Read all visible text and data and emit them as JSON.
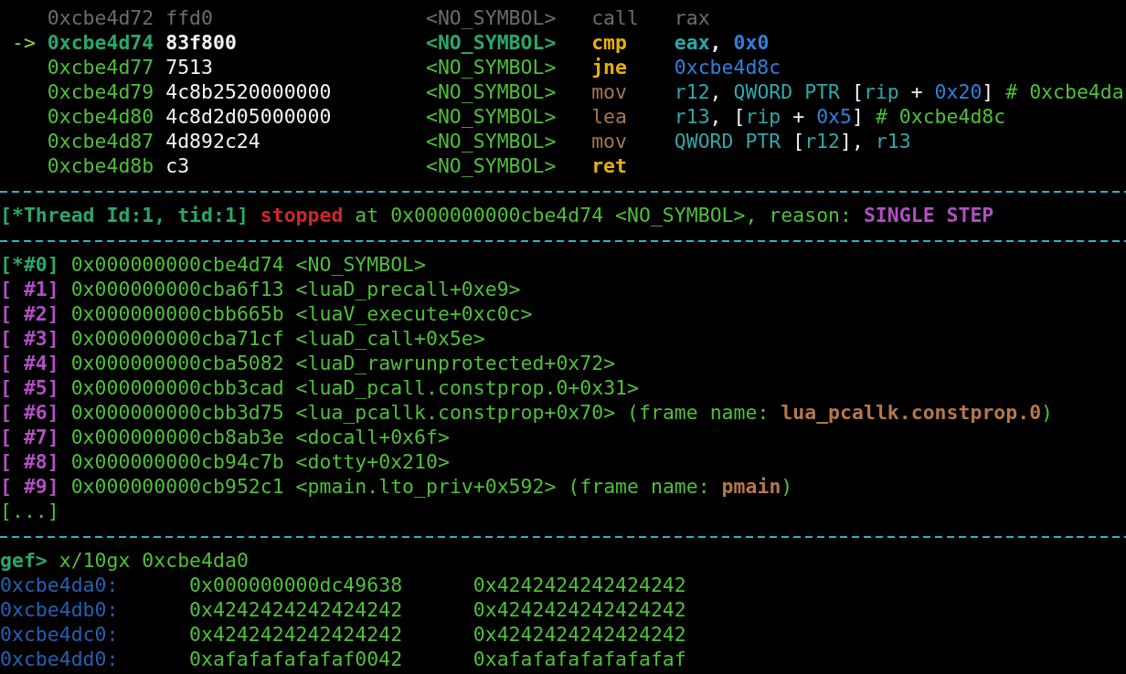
{
  "disassembly": [
    {
      "current": false,
      "dimmed": true,
      "address": "0xcbe4d72",
      "bytes": "ffd0",
      "symbol": "<NO_SYMBOL>",
      "mnemonic": "call",
      "emphasized": false,
      "operands": [
        {
          "text": "rax",
          "kind": "register"
        }
      ]
    },
    {
      "current": true,
      "dimmed": false,
      "marker": "->",
      "address": "0xcbe4d74",
      "bytes": "83f800",
      "symbol": "<NO_SYMBOL>",
      "mnemonic": "cmp",
      "emphasized": true,
      "operands": [
        {
          "text": "eax",
          "kind": "register"
        },
        {
          "text": ", ",
          "kind": "punct"
        },
        {
          "text": "0x0",
          "kind": "immediate"
        }
      ]
    },
    {
      "current": false,
      "dimmed": false,
      "address": "0xcbe4d77",
      "bytes": "7513",
      "symbol": "<NO_SYMBOL>",
      "mnemonic": "jne",
      "emphasized": true,
      "operands": [
        {
          "text": "0xcbe4d8c",
          "kind": "immediate"
        }
      ]
    },
    {
      "current": false,
      "dimmed": false,
      "address": "0xcbe4d79",
      "bytes": "4c8b2520000000",
      "symbol": "<NO_SYMBOL>",
      "mnemonic": "mov",
      "emphasized": false,
      "operands": [
        {
          "text": "r12",
          "kind": "register"
        },
        {
          "text": ", ",
          "kind": "punct"
        },
        {
          "text": "QWORD PTR",
          "kind": "register"
        },
        {
          "text": " [",
          "kind": "punct"
        },
        {
          "text": "rip",
          "kind": "register"
        },
        {
          "text": " + ",
          "kind": "punct"
        },
        {
          "text": "0x20",
          "kind": "immediate"
        },
        {
          "text": "] ",
          "kind": "punct"
        },
        {
          "text": "# 0xcbe4da",
          "kind": "comment"
        }
      ]
    },
    {
      "current": false,
      "dimmed": false,
      "address": "0xcbe4d80",
      "bytes": "4c8d2d05000000",
      "symbol": "<NO_SYMBOL>",
      "mnemonic": "lea",
      "emphasized": false,
      "operands": [
        {
          "text": "r13",
          "kind": "register"
        },
        {
          "text": ", [",
          "kind": "punct"
        },
        {
          "text": "rip",
          "kind": "register"
        },
        {
          "text": " + ",
          "kind": "punct"
        },
        {
          "text": "0x5",
          "kind": "immediate"
        },
        {
          "text": "] ",
          "kind": "punct"
        },
        {
          "text": "# 0xcbe4d8c",
          "kind": "comment"
        }
      ]
    },
    {
      "current": false,
      "dimmed": false,
      "address": "0xcbe4d87",
      "bytes": "4d892c24",
      "symbol": "<NO_SYMBOL>",
      "mnemonic": "mov",
      "emphasized": false,
      "operands": [
        {
          "text": "QWORD PTR",
          "kind": "register"
        },
        {
          "text": " [",
          "kind": "punct"
        },
        {
          "text": "r12",
          "kind": "register"
        },
        {
          "text": "], ",
          "kind": "punct"
        },
        {
          "text": "r13",
          "kind": "register"
        }
      ]
    },
    {
      "current": false,
      "dimmed": false,
      "address": "0xcbe4d8b",
      "bytes": "c3",
      "symbol": "<NO_SYMBOL>",
      "mnemonic": "ret",
      "emphasized": true
    }
  ],
  "thread": {
    "label": "[*Thread Id:1, tid:1]",
    "status": "stopped",
    "detail": "at 0x000000000cbe4d74 <NO_SYMBOL>, reason:",
    "reason": "SINGLE STEP"
  },
  "frames": [
    {
      "index": "[*#0]",
      "selected": true,
      "address": "0x000000000cbe4d74",
      "symbol": "<NO_SYMBOL>"
    },
    {
      "index": "[ #1]",
      "selected": false,
      "address": "0x000000000cba6f13",
      "symbol": "<luaD_precall+0xe9>"
    },
    {
      "index": "[ #2]",
      "selected": false,
      "address": "0x000000000cbb665b",
      "symbol": "<luaV_execute+0xc0c>"
    },
    {
      "index": "[ #3]",
      "selected": false,
      "address": "0x000000000cba71cf",
      "symbol": "<luaD_call+0x5e>"
    },
    {
      "index": "[ #4]",
      "selected": false,
      "address": "0x000000000cba5082",
      "symbol": "<luaD_rawrunprotected+0x72>"
    },
    {
      "index": "[ #5]",
      "selected": false,
      "address": "0x000000000cbb3cad",
      "symbol": "<luaD_pcall.constprop.0+0x31>"
    },
    {
      "index": "[ #6]",
      "selected": false,
      "address": "0x000000000cbb3d75",
      "symbol": "<lua_pcallk.constprop+0x70>",
      "frame_name": {
        "label": "(frame name:",
        "value": "lua_pcallk.constprop.0",
        "close": ")"
      }
    },
    {
      "index": "[ #7]",
      "selected": false,
      "address": "0x000000000cb8ab3e",
      "symbol": "<docall+0x6f>"
    },
    {
      "index": "[ #8]",
      "selected": false,
      "address": "0x000000000cb94c7b",
      "symbol": "<dotty+0x210>"
    },
    {
      "index": "[ #9]",
      "selected": false,
      "address": "0x000000000cb952c1",
      "symbol": "<pmain.lto_priv+0x592>",
      "frame_name": {
        "label": "(frame name:",
        "value": "pmain",
        "close": ")"
      }
    }
  ],
  "frames_more": "[...]",
  "prompt": {
    "label": "gef>",
    "command": "x/10gx 0xcbe4da0"
  },
  "memory": [
    {
      "address": "0xcbe4da0:",
      "values": [
        "0x000000000dc49638",
        "0x4242424242424242"
      ]
    },
    {
      "address": "0xcbe4db0:",
      "values": [
        "0x4242424242424242",
        "0x4242424242424242"
      ]
    },
    {
      "address": "0xcbe4dc0:",
      "values": [
        "0x4242424242424242",
        "0x4242424242424242"
      ]
    },
    {
      "address": "0xcbe4dd0:",
      "values": [
        "0xafafafafafaf0042",
        "0xafafafafafafafaf"
      ]
    }
  ]
}
